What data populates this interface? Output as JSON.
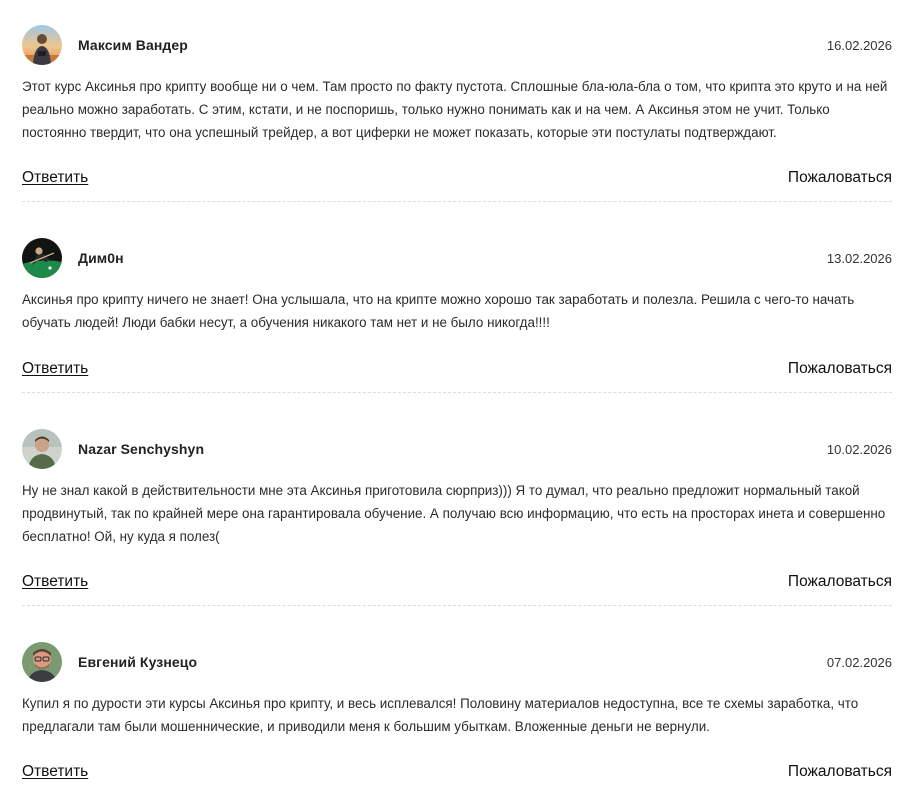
{
  "comments": [
    {
      "author": "Максим Вандер",
      "date": "16.02.2026",
      "text": "Этот курс Аксинья про крипту вообще ни о чем. Там просто по факту пустота. Сплошные бла-юла-бла о том, что крипта это круто и на ней реально можно заработать. С этим, кстати, и не поспоришь, только нужно понимать как и на чем. А Аксинья этом не учит. Только постоянно твердит, что она успешный трейдер, а вот циферки не может показать, которые эти постулаты подтверждают.",
      "reply": "Ответить",
      "report": "Пожаловаться",
      "avatar_icon": "user-photo-sunset"
    },
    {
      "author": "Дим0н",
      "date": "13.02.2026",
      "text": "Аксинья про крипту ничего не знает! Она услышала, что на крипте можно хорошо так заработать и полезла. Решила с чего-то начать обучать людей! Люди бабки несут, а обучения никакого там нет и не было никогда!!!!",
      "reply": "Ответить",
      "report": "Пожаловаться",
      "avatar_icon": "user-photo-billiards"
    },
    {
      "author": "Nazar Senchyshyn",
      "date": "10.02.2026",
      "text": "Ну не знал какой в действительности мне эта Аксинья приготовила сюрприз))) Я то думал, что реально предложит нормальный такой продвинутый, так по крайней мере она гарантировала обучение. А получаю всю информацию, что есть на просторах инета и совершенно бесплатно! Ой, ну куда я полез(",
      "reply": "Ответить",
      "report": "Пожаловаться",
      "avatar_icon": "user-photo-portrait"
    },
    {
      "author": "Евгений Кузнецо",
      "date": "07.02.2026",
      "text": "Купил я по дурости эти курсы Аксинья про крипту, и весь исплевался! Половину материалов недоступна, все те схемы заработка, что предлагали там были мошеннические, и приводили меня к большим убыткам. Вложенные деньги не вернули.",
      "reply": "Ответить",
      "report": "Пожаловаться",
      "avatar_icon": "user-photo-glasses"
    }
  ],
  "colors": {
    "text": "#222222",
    "divider": "#dcdcdc",
    "background": "#ffffff"
  }
}
